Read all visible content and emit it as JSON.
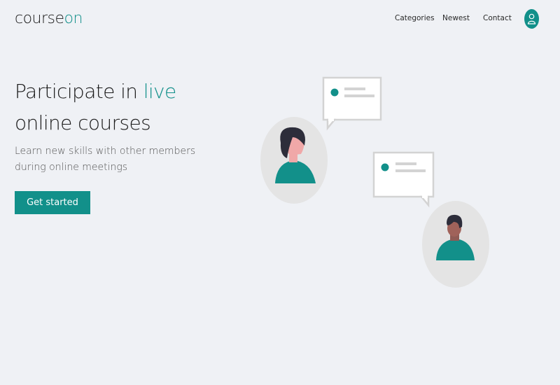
{
  "logo": {
    "prefix": "course",
    "suffix": "on"
  },
  "nav": {
    "items": [
      "Categories",
      "Newest",
      "Contact"
    ]
  },
  "hero": {
    "title_line1_prefix": "Participate in ",
    "title_line1_accent": "live",
    "title_line2": "online courses",
    "subtitle_line1": "Learn new skills with other members",
    "subtitle_line2": "during online meetings",
    "cta_label": "Get started"
  },
  "colors": {
    "accent": "#12908a",
    "background": "#eff1f5",
    "bubble_border": "#d3d3d3",
    "avatar_circle": "#e4e4e4"
  },
  "icons": {
    "account": "user-icon",
    "chat_dot": "message-dot-icon"
  }
}
